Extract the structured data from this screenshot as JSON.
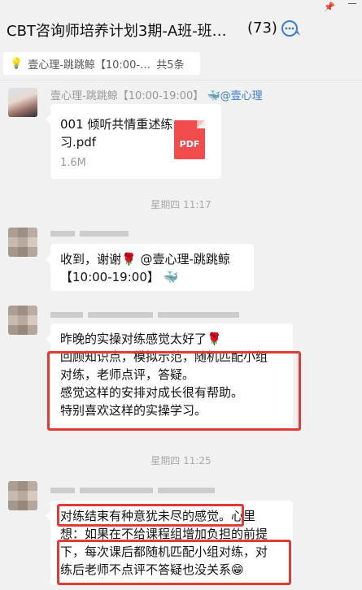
{
  "window": {
    "title": "CBT咨询师培养计划3期-A班-班…",
    "member_count": "(73)",
    "pin_icon": "pin-icon",
    "minimize_icon": "minimize-icon"
  },
  "pinned": {
    "text": "壹心理-跳跳鲸【10:00-…",
    "count": "共5条"
  },
  "messages": [
    {
      "sender": "壹心理-跳跳鲸【10:00-19:00】",
      "sender_tag": "@壹心理",
      "file": {
        "name": "001 倾听共情重述练习.pdf",
        "size": "1.6M",
        "type": "PDF"
      }
    },
    {
      "timestamp": "星期四 11:17"
    },
    {
      "line1": "收到，谢谢🌹 @壹心理-跳跳鲸",
      "line2": "【10:00-19:00】"
    },
    {
      "lines": [
        "昨晚的实操对练感觉太好了🌹",
        "回顾知识点，模拟示范，随机匹配小组",
        "对练，老师点评，答疑。",
        "感觉这样的安排对成长很有帮助。",
        "特别喜欢这样的实操学习。"
      ]
    },
    {
      "timestamp": "星期四 11:25"
    },
    {
      "lines": [
        "对练结束有种意犹未尽的感觉。心里",
        "想：如果在不给课程组增加负担的前提",
        "下，每次课后都随机匹配小组对练，对",
        "练后老师不点评不答疑也没关系😁"
      ]
    }
  ]
}
